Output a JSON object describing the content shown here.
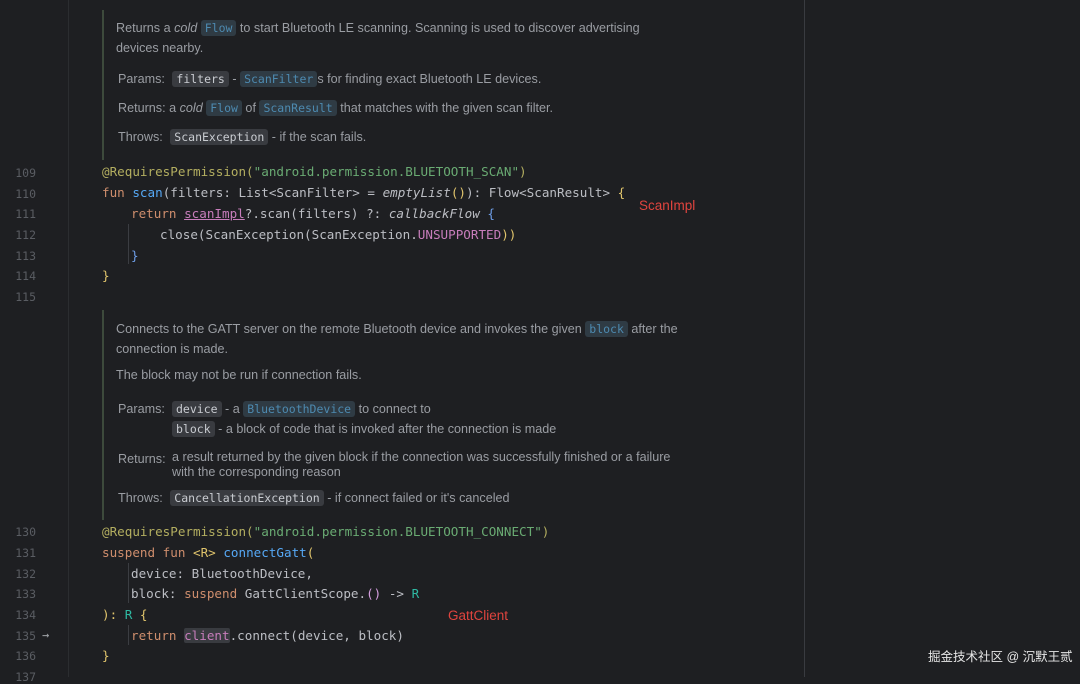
{
  "doc1": {
    "desc_a": "Returns a ",
    "desc_cold": "cold",
    "desc_flow": "Flow",
    "desc_b": " to start Bluetooth LE scanning. Scanning is used to discover advertising",
    "desc_c": "devices nearby.",
    "params_label": "Params:",
    "params_name": "filters",
    "params_dash": " - ",
    "params_type": "ScanFilter",
    "params_text": "s for finding exact Bluetooth LE devices.",
    "returns_label": "Returns:",
    "returns_a": " a ",
    "returns_cold": "cold",
    "returns_flow": "Flow",
    "returns_of": " of ",
    "returns_type": "ScanResult",
    "returns_text": " that matches with the given scan filter.",
    "throws_label": "Throws:",
    "throws_name": "ScanException",
    "throws_text": " - if the scan fails."
  },
  "doc2": {
    "desc_a": "Connects to the GATT server on the remote Bluetooth device and invokes the given ",
    "desc_block": "block",
    "desc_b": " after the",
    "desc_c": "connection is made.",
    "desc_d": "The block may not be run if connection fails.",
    "params_label": "Params:",
    "p1_name": "device",
    "p1_dash": " - a ",
    "p1_type": "BluetoothDevice",
    "p1_text": " to connect to",
    "p2_name": "block",
    "p2_text": " - a block of code that is invoked after the connection is made",
    "returns_label": "Returns:",
    "returns_text1": "a result returned by the given block if the connection was successfully finished or a failure",
    "returns_text2": "with the corresponding reason",
    "throws_label": "Throws:",
    "throws_name": "CancellationException",
    "throws_text": " - if connect failed or it's canceled"
  },
  "line_numbers": [
    "109",
    "110",
    "111",
    "112",
    "113",
    "114",
    "115",
    "130",
    "131",
    "132",
    "133",
    "134",
    "135",
    "136",
    "137"
  ],
  "code": {
    "l109_ann": "@RequiresPermission(",
    "l109_str": "\"android.permission.BLUETOOTH_SCAN\"",
    "l109_end": ")",
    "l110_fun": "fun ",
    "l110_name": "scan",
    "l110_a": "(filters: List<ScanFilter> = ",
    "l110_empty": "emptyList",
    "l110_b": "()",
    "l110_c": "): Flow<ScanResult> ",
    "l110_brace": "{",
    "l111_ret": "return ",
    "l111_impl": "scanImpl",
    "l111_a": "?.scan(filters) ?: ",
    "l111_cb": "callbackFlow",
    "l111_brace": " {",
    "l112_a": "close(ScanException(ScanException.",
    "l112_const": "UNSUPPORTED",
    "l112_b": "))",
    "l113": "}",
    "l114": "}",
    "l130_ann": "@RequiresPermission(",
    "l130_str": "\"android.permission.BLUETOOTH_CONNECT\"",
    "l130_end": ")",
    "l131_susp": "suspend fun ",
    "l131_gen": "<R>",
    "l131_name": " connectGatt",
    "l131_paren": "(",
    "l132": "device: BluetoothDevice,",
    "l133_a": "block: ",
    "l133_susp": "suspend ",
    "l133_b": "GattClientScope.",
    "l133_c": "()",
    "l133_d": " -> ",
    "l133_r": "R",
    "l134_a": "): ",
    "l134_r": "R",
    "l134_b": " {",
    "l135_ret": "return ",
    "l135_client": "client",
    "l135_a": ".connect(device, block)",
    "l136": "}"
  },
  "labels": {
    "scan_impl": "ScanImpl",
    "gatt_client": "GattClient"
  },
  "watermark": "掘金技术社区 @ 沉默王贰",
  "colors": {
    "background": "#1e1f22",
    "keyword": "#cf8e6d",
    "string": "#6aab73",
    "function": "#56a8f5",
    "annotation": "#b3ae60",
    "red_label": "#e0443e"
  }
}
